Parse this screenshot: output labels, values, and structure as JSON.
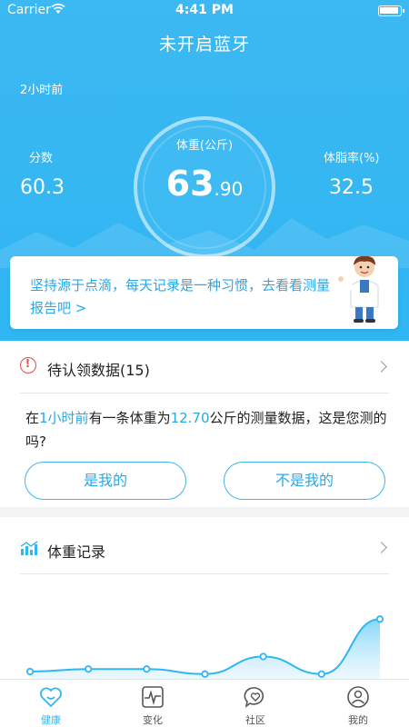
{
  "status_bar": {
    "carrier": "Carrier",
    "time": "4:41 PM"
  },
  "header": {
    "title": "未开启蓝牙",
    "time_ago": "2小时前",
    "weight_label": "体重(公斤)",
    "weight_int": "63",
    "weight_dec": ".90",
    "score_label": "分数",
    "score_value": "60.3",
    "fat_label": "体脂率(%)",
    "fat_value": "32.5"
  },
  "notice": {
    "text": "坚持源于点滴，每天记录是一种习惯，去看看测量报告吧 >"
  },
  "pending": {
    "title": "待认领数据(15)",
    "msg_prefix": "在",
    "msg_time": "1小时前",
    "msg_mid": "有一条体重为",
    "msg_weight": "12.70",
    "msg_suffix": "公斤的测量数据，这是您测的吗?",
    "yes_label": "是我的",
    "no_label": "不是我的"
  },
  "records": {
    "title": "体重记录"
  },
  "chart_data": {
    "type": "area",
    "values": [
      4,
      4.5,
      4.5,
      3.5,
      7,
      3.5,
      14.5
    ],
    "ylim": [
      0,
      20
    ]
  },
  "tabs": [
    {
      "label": "健康",
      "icon": "heart-face-icon",
      "active": true
    },
    {
      "label": "变化",
      "icon": "pulse-icon",
      "active": false
    },
    {
      "label": "社区",
      "icon": "chat-heart-icon",
      "active": false
    },
    {
      "label": "我的",
      "icon": "user-icon",
      "active": false
    }
  ],
  "colors": {
    "primary": "#2fb6f3",
    "accent_text": "#28a8e8",
    "warning": "#e84a4a"
  }
}
